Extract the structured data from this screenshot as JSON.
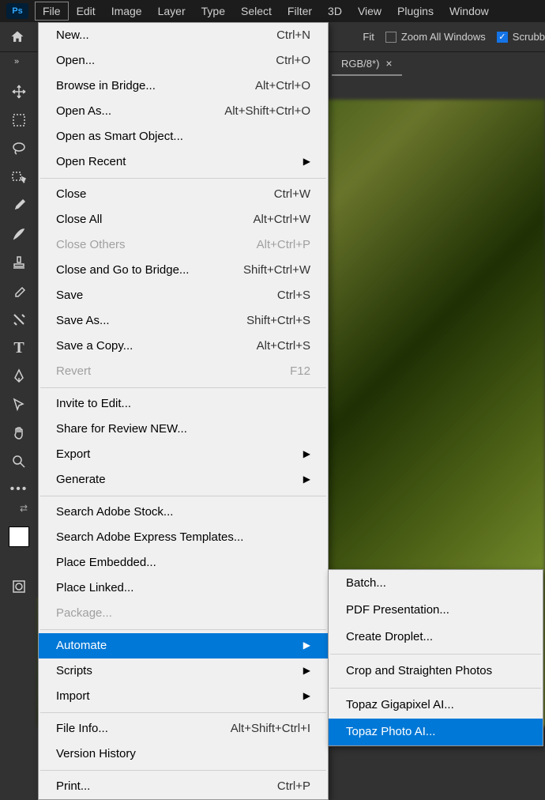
{
  "menubar": {
    "items": [
      "File",
      "Edit",
      "Image",
      "Layer",
      "Type",
      "Select",
      "Filter",
      "3D",
      "View",
      "Plugins",
      "Window"
    ]
  },
  "options": {
    "fit": "Fit",
    "zoom_all": "Zoom All Windows",
    "scrubby": "Scrubb"
  },
  "tab": {
    "title": "RGB/8*)"
  },
  "file_menu": [
    {
      "label": "New...",
      "shortcut": "Ctrl+N"
    },
    {
      "label": "Open...",
      "shortcut": "Ctrl+O"
    },
    {
      "label": "Browse in Bridge...",
      "shortcut": "Alt+Ctrl+O"
    },
    {
      "label": "Open As...",
      "shortcut": "Alt+Shift+Ctrl+O"
    },
    {
      "label": "Open as Smart Object..."
    },
    {
      "label": "Open Recent",
      "submenu": true
    },
    {
      "sep": true
    },
    {
      "label": "Close",
      "shortcut": "Ctrl+W"
    },
    {
      "label": "Close All",
      "shortcut": "Alt+Ctrl+W"
    },
    {
      "label": "Close Others",
      "shortcut": "Alt+Ctrl+P",
      "disabled": true
    },
    {
      "label": "Close and Go to Bridge...",
      "shortcut": "Shift+Ctrl+W"
    },
    {
      "label": "Save",
      "shortcut": "Ctrl+S"
    },
    {
      "label": "Save As...",
      "shortcut": "Shift+Ctrl+S"
    },
    {
      "label": "Save a Copy...",
      "shortcut": "Alt+Ctrl+S"
    },
    {
      "label": "Revert",
      "shortcut": "F12",
      "disabled": true
    },
    {
      "sep": true
    },
    {
      "label": "Invite to Edit..."
    },
    {
      "label": "Share for Review NEW..."
    },
    {
      "label": "Export",
      "submenu": true
    },
    {
      "label": "Generate",
      "submenu": true
    },
    {
      "sep": true
    },
    {
      "label": "Search Adobe Stock..."
    },
    {
      "label": "Search Adobe Express Templates..."
    },
    {
      "label": "Place Embedded..."
    },
    {
      "label": "Place Linked..."
    },
    {
      "label": "Package...",
      "disabled": true
    },
    {
      "sep": true
    },
    {
      "label": "Automate",
      "submenu": true,
      "highlighted": true
    },
    {
      "label": "Scripts",
      "submenu": true
    },
    {
      "label": "Import",
      "submenu": true
    },
    {
      "sep": true
    },
    {
      "label": "File Info...",
      "shortcut": "Alt+Shift+Ctrl+I"
    },
    {
      "label": "Version History"
    },
    {
      "sep": true
    },
    {
      "label": "Print...",
      "shortcut": "Ctrl+P"
    }
  ],
  "automate_submenu": [
    {
      "label": "Batch..."
    },
    {
      "label": "PDF Presentation..."
    },
    {
      "label": "Create Droplet..."
    },
    {
      "sep": true
    },
    {
      "label": "Crop and Straighten Photos"
    },
    {
      "sep": true
    },
    {
      "label": "Topaz Gigapixel AI..."
    },
    {
      "label": "Topaz Photo AI...",
      "highlighted": true
    }
  ]
}
